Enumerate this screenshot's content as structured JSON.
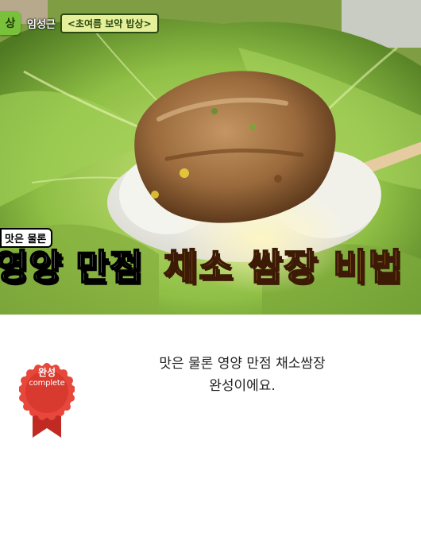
{
  "video_still": {
    "show_logo_text": "상",
    "host_name": "임성근",
    "episode_title": "<초여름 보약 밥상>",
    "caption_small": "맛은 물론",
    "caption_white": "영양 만점",
    "caption_gold": "채소 쌈장 비법"
  },
  "body": {
    "line1": "맛은 물론 영양 만점 채소쌈장",
    "line2": "완성이에요."
  },
  "badge": {
    "label_ko": "완성",
    "label_en": "complete",
    "color": "#d93a2f",
    "ribbon_color": "#c02a22"
  }
}
